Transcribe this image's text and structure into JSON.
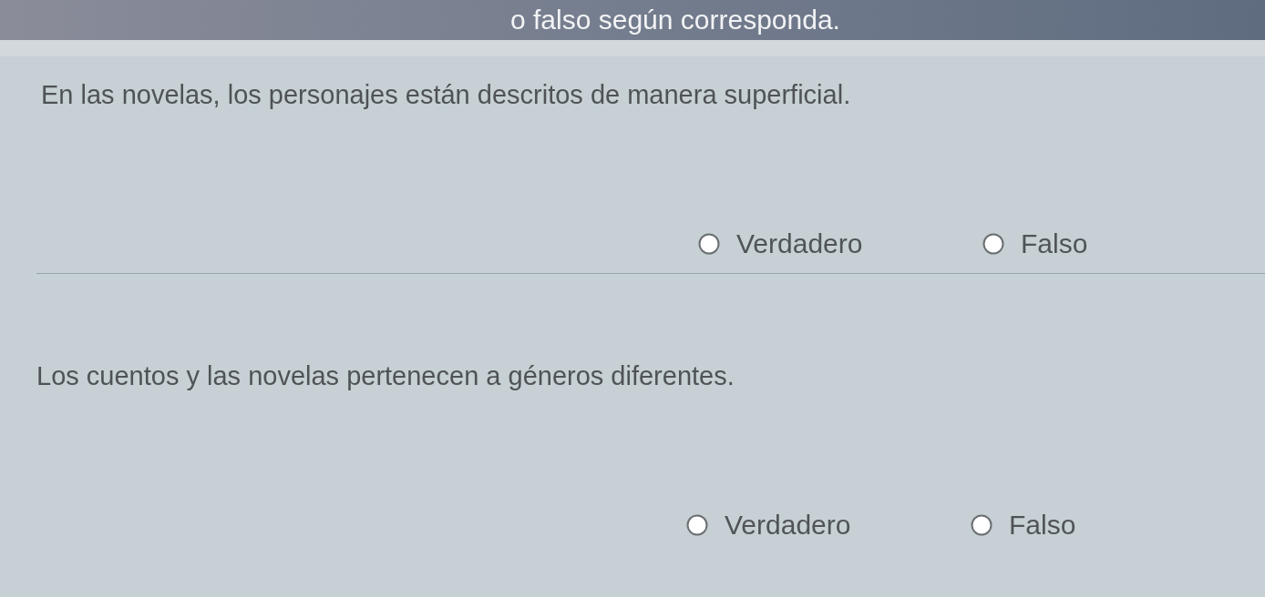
{
  "header": {
    "instruction": "o falso según corresponda."
  },
  "questions": [
    {
      "statement": "En las novelas, los personajes están descritos de manera superficial.",
      "options": [
        {
          "label": "Verdadero",
          "selected": false
        },
        {
          "label": "Falso",
          "selected": false
        }
      ]
    },
    {
      "statement": "Los cuentos y las novelas pertenecen a géneros diferentes.",
      "options": [
        {
          "label": "Verdadero",
          "selected": false
        },
        {
          "label": "Falso",
          "selected": false
        }
      ]
    }
  ]
}
